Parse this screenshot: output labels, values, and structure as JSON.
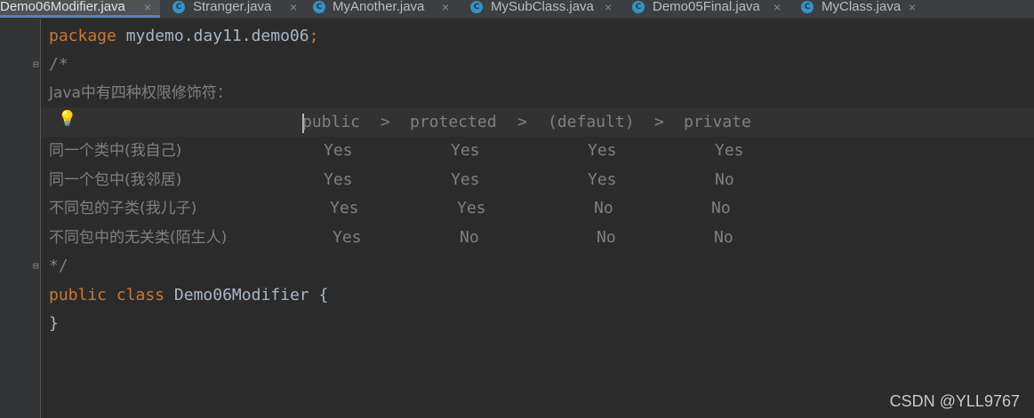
{
  "tabs": [
    {
      "label": "Demo06Modifier.java",
      "active": true,
      "icon": "class-icon"
    },
    {
      "label": "Stranger.java",
      "active": false,
      "icon": "class-icon"
    },
    {
      "label": "MyAnother.java",
      "active": false,
      "icon": "class-icon"
    },
    {
      "label": "MySubClass.java",
      "active": false,
      "icon": "class-icon"
    },
    {
      "label": "Demo05Final.java",
      "active": false,
      "icon": "class-icon"
    },
    {
      "label": "MyClass.java",
      "active": false,
      "icon": "class-icon"
    }
  ],
  "tab_close_glyph": "×",
  "code": {
    "package_kw": "package",
    "package_name": " mydemo.day11.demo06",
    "semicolon": ";",
    "comment_open": "/*",
    "comment_title": "Java中有四种权限修饰符：",
    "header": {
      "public": "public",
      "gt1": ">",
      "protected": "protected",
      "gt2": ">",
      "default": "(default)",
      "gt3": ">",
      "private": "private"
    },
    "rows": [
      {
        "label": "同一个类中(我自己)",
        "cells": [
          "Yes",
          "Yes",
          "Yes",
          "Yes"
        ]
      },
      {
        "label": "同一个包中(我邻居)",
        "cells": [
          "Yes",
          "Yes",
          "Yes",
          "No"
        ]
      },
      {
        "label": "不同包的子类(我儿子)",
        "cells": [
          "Yes",
          "Yes",
          "No",
          "No"
        ]
      },
      {
        "label": "不同包中的无关类(陌生人)",
        "cells": [
          "Yes",
          "No",
          "No",
          "No"
        ]
      }
    ],
    "comment_close": "*/",
    "class_kw_public": "public",
    "class_kw_class": "class",
    "class_name": "Demo06Modifier",
    "open_brace": "{",
    "close_brace": "}"
  },
  "watermark": "CSDN @YLL9767",
  "colors": {
    "keyword": "#cc7832",
    "comment": "#808080",
    "text": "#a9b7c6",
    "tab_accent": "#4a88c7"
  }
}
